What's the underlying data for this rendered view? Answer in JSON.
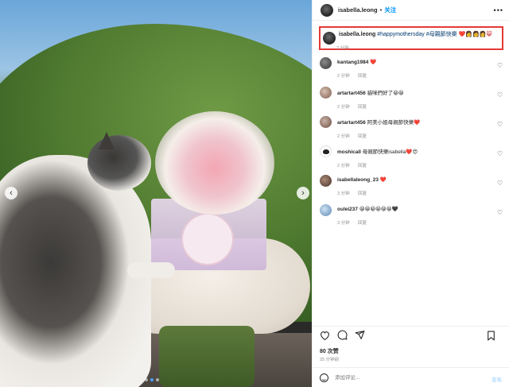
{
  "header": {
    "username": "isabella.leong",
    "separator": "•",
    "follow_label": "关注",
    "more_label": "•••"
  },
  "caption": {
    "username": "isabella.leong",
    "hashtag_1": "#happymothersday",
    "hashtag_2": "#母親節快樂",
    "emojis": "❤️👩👩👩😸",
    "time": "2 分钟"
  },
  "comments": [
    {
      "username": "kantang1984",
      "text": "❤️",
      "time": "2 分钟",
      "reply_label": "回复"
    },
    {
      "username": "artartart456",
      "text": "貓咪們好了😀😀",
      "time": "2 分钟",
      "reply_label": "回复"
    },
    {
      "username": "artartart456",
      "text": "阿美小姐母親節快樂❤️",
      "time": "2 分钟",
      "reply_label": "回复"
    },
    {
      "username": "moshicall",
      "text": "母親節快樂isabella❤️😍",
      "time": "2 分钟",
      "reply_label": "回复"
    },
    {
      "username": "isabellaleong_23",
      "text": "❤️",
      "time": "3 分钟",
      "reply_label": "回复"
    },
    {
      "username": "oulei237",
      "text": "😀😀😀😀😀😀🖤",
      "time": "3 分钟",
      "reply_label": "回复"
    }
  ],
  "stats": {
    "likes": "80 次赞",
    "posted": "25 分钟前"
  },
  "composer": {
    "placeholder": "添加评论...",
    "post_label": "发布"
  },
  "carousel": {
    "active_index": 1,
    "total": 3
  },
  "colors": {
    "accent": "#0095f6",
    "highlight_border": "#e53935",
    "hashtag": "#00376b"
  }
}
